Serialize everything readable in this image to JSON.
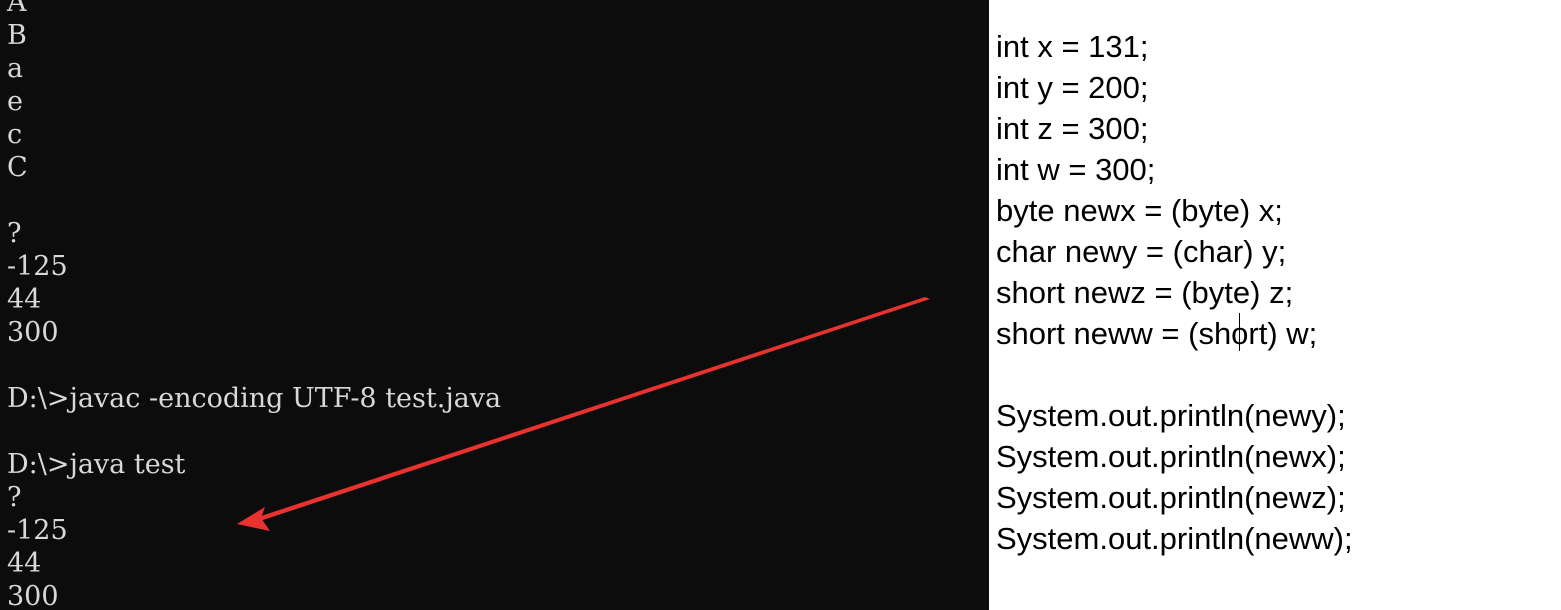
{
  "terminal": {
    "lines": [
      "A",
      "B",
      "a",
      "e",
      "c",
      "C",
      "",
      "?",
      "-125",
      "44",
      "300",
      "",
      "D:\\>javac -encoding UTF-8 test.java",
      "",
      "D:\\>java test",
      "?",
      "-125",
      "44",
      "300"
    ]
  },
  "editor": {
    "lines": [
      "int x = 131;",
      "int y = 200;",
      "int z = 300;",
      "int w = 300;",
      "byte newx = (byte) x;",
      "char newy = (char) y;",
      "short newz = (byte) z;",
      "short neww = (short) w;",
      "",
      "System.out.println(newy);",
      "System.out.println(newx);",
      "System.out.println(newz);",
      "System.out.println(neww);"
    ]
  },
  "annotation": {
    "arrow_color": "#e8322f"
  }
}
